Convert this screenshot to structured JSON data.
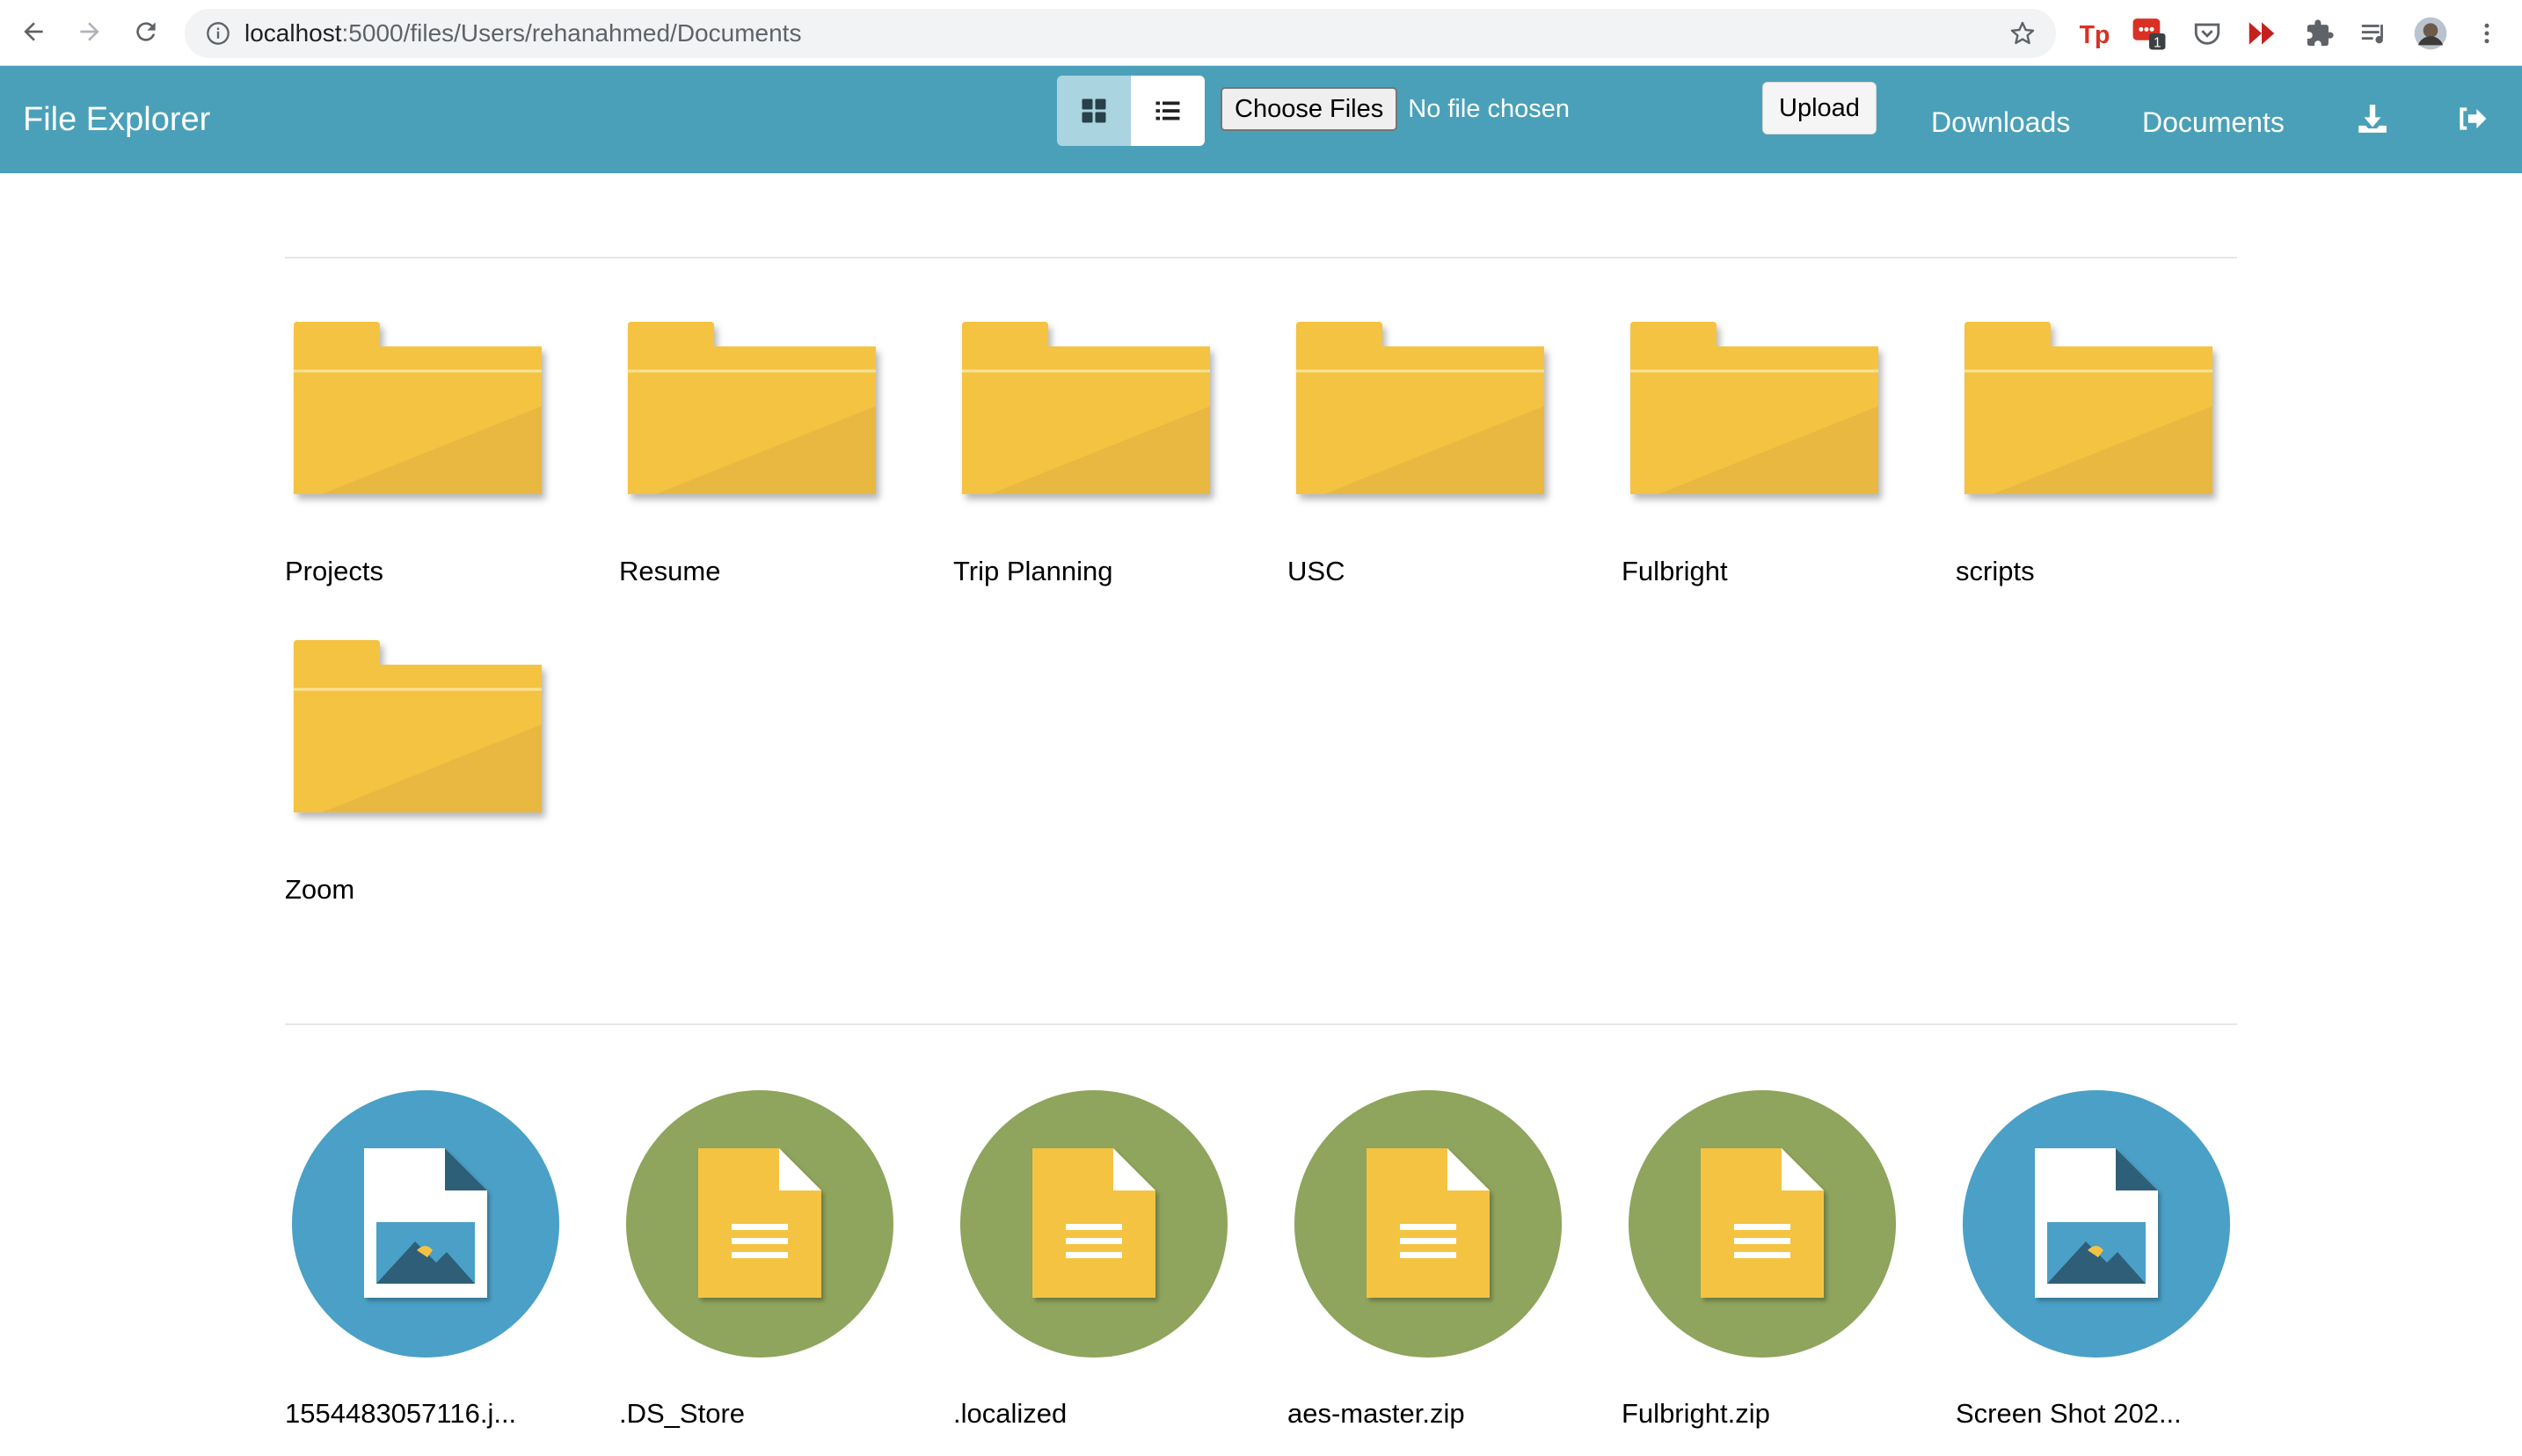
{
  "browser": {
    "url_host": "localhost",
    "url_path": ":5000/files/Users/rehanahmed/Documents",
    "extension_badge": "1"
  },
  "app": {
    "title": "File Explorer",
    "choose_files_label": "Choose Files",
    "no_file_label": "No file chosen",
    "upload_label": "Upload",
    "nav_links": [
      "Downloads",
      "Documents"
    ]
  },
  "folders": [
    "Projects",
    "Resume",
    "Trip Planning",
    "USC",
    "Fulbright",
    "scripts",
    "Zoom"
  ],
  "files": [
    {
      "name": "1554483057116.j...",
      "icon": "image-file-icon",
      "color": "#4aa0c6"
    },
    {
      "name": ".DS_Store",
      "icon": "document-file-icon",
      "color": "#8fa45c"
    },
    {
      "name": ".localized",
      "icon": "document-file-icon",
      "color": "#8fa45c"
    },
    {
      "name": "aes-master.zip",
      "icon": "document-file-icon",
      "color": "#8fa45c"
    },
    {
      "name": "Fulbright.zip",
      "icon": "document-file-icon",
      "color": "#8fa45c"
    },
    {
      "name": "Screen Shot 202...",
      "icon": "image-file-icon",
      "color": "#4aa0c6"
    }
  ],
  "colors": {
    "header": "#4aa0b8",
    "folder": "#f4c343",
    "folder_shade": "#e8b840",
    "image_circle": "#4aa0c6",
    "doc_circle": "#8fa45c"
  }
}
